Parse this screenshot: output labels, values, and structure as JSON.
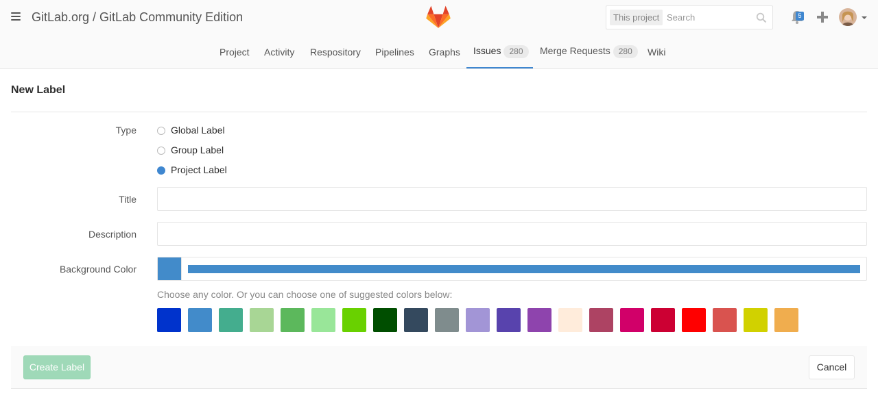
{
  "header": {
    "project_title": "GitLab.org / GitLab Community Edition",
    "search_scope": "This project",
    "search_placeholder": "Search",
    "notification_count": "5",
    "brand_color": "#fc6d26"
  },
  "nav": {
    "items": [
      {
        "label": "Project"
      },
      {
        "label": "Activity"
      },
      {
        "label": "Respository"
      },
      {
        "label": "Pipelines"
      },
      {
        "label": "Graphs"
      },
      {
        "label": "Issues",
        "count": "280",
        "active": true
      },
      {
        "label": "Merge Requests",
        "count": "280"
      },
      {
        "label": "Wiki"
      }
    ],
    "active_color": "#3f87d0"
  },
  "page": {
    "title": "New Label"
  },
  "form": {
    "type_label": "Type",
    "type_options": [
      {
        "label": "Global Label",
        "checked": false
      },
      {
        "label": "Group Label",
        "checked": false
      },
      {
        "label": "Project Label",
        "checked": true
      }
    ],
    "title_label": "Title",
    "title_value": "",
    "description_label": "Description",
    "description_value": "",
    "bg_color_label": "Background Color",
    "selected_color": "#428bca",
    "color_hint": "Choose any color. Or you can choose one of suggested colors below:",
    "suggested_colors": [
      "#0033cc",
      "#428bca",
      "#44ad8e",
      "#a8d695",
      "#5cb85c",
      "#99e699",
      "#69d100",
      "#004e00",
      "#34495e",
      "#7f8c8d",
      "#a295d6",
      "#5843ad",
      "#8e44ad",
      "#ffecdb",
      "#ad4363",
      "#d10069",
      "#cc0033",
      "#ff0000",
      "#d9534f",
      "#d1d100",
      "#f0ad4e"
    ]
  },
  "actions": {
    "create_label": "Create Label",
    "cancel_label": "Cancel"
  }
}
